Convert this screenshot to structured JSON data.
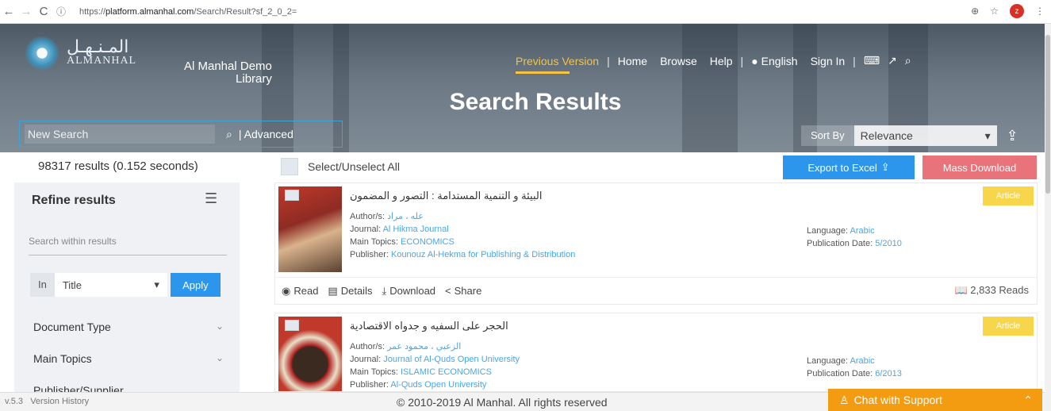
{
  "browser": {
    "url_prefix": "https://",
    "url_host": "platform.almanhal.com",
    "url_path": "/Search/Result?sf_2_0_2=",
    "profile_initial": "z"
  },
  "header": {
    "logo_arabic": "المـنـهـل",
    "logo_english": "ALMANHAL",
    "library_name_line1": "Al Manhal Demo",
    "library_name_line2": "Library",
    "nav": {
      "previous_version": "Previous Version",
      "home": "Home",
      "browse": "Browse",
      "help": "Help",
      "language": "English",
      "sign_in": "Sign In"
    },
    "page_title": "Search Results",
    "search_placeholder": "New Search",
    "advanced_label": "Advanced",
    "sort_by_label": "Sort By",
    "sort_value": "Relevance"
  },
  "results_bar": {
    "count_text": "98317 results (0.152 seconds)",
    "select_all_label": "Select/Unselect All",
    "export_label": "Export to Excel",
    "mass_download_label": "Mass Download"
  },
  "sidebar": {
    "title": "Refine results",
    "search_placeholder": "Search within results",
    "in_label": "In",
    "field_value": "Title",
    "apply_label": "Apply",
    "facets": [
      "Document Type",
      "Main Topics",
      "Publisher/Supplier"
    ]
  },
  "results": [
    {
      "title": "البيئة و التنمية المستدامة : التصور و المضمون",
      "author_label": "Author/s:",
      "author": "عله ، مراد",
      "journal_label": "Journal:",
      "journal": "Al Hikma Journal",
      "topics_label": "Main Topics:",
      "topics": "ECONOMICS",
      "publisher_label": "Publisher:",
      "publisher": "Kounouz Al-Hekma for Publishing & Distribution",
      "language_label": "Language:",
      "language": "Arabic",
      "date_label": "Publication Date:",
      "date": "5/2010",
      "type": "Article",
      "reads": "2,833 Reads"
    },
    {
      "title": "الحجر على السفيه و جدواه الاقتصادية",
      "author_label": "Author/s:",
      "author": "الزعبي ، محمود عمر",
      "journal_label": "Journal:",
      "journal": "Journal of Al-Quds Open University",
      "topics_label": "Main Topics:",
      "topics": "ISLAMIC ECONOMICS",
      "publisher_label": "Publisher:",
      "publisher": "Al-Quds Open University",
      "language_label": "Language:",
      "language": "Arabic",
      "date_label": "Publication Date:",
      "date": "6/2013",
      "type": "Article"
    }
  ],
  "actions": {
    "read": "Read",
    "details": "Details",
    "download": "Download",
    "share": "Share"
  },
  "footer": {
    "version": "v.5.3",
    "version_history": "Version History",
    "copyright": "© 2010-2019 Al Manhal. All rights reserved",
    "chat_label": "Chat with Support"
  },
  "colors": {
    "accent_blue": "#2b96ec",
    "mass_download": "#e8737a",
    "article_badge": "#f8d64b",
    "chat": "#f39c12",
    "prev_version": "#f6c343"
  }
}
